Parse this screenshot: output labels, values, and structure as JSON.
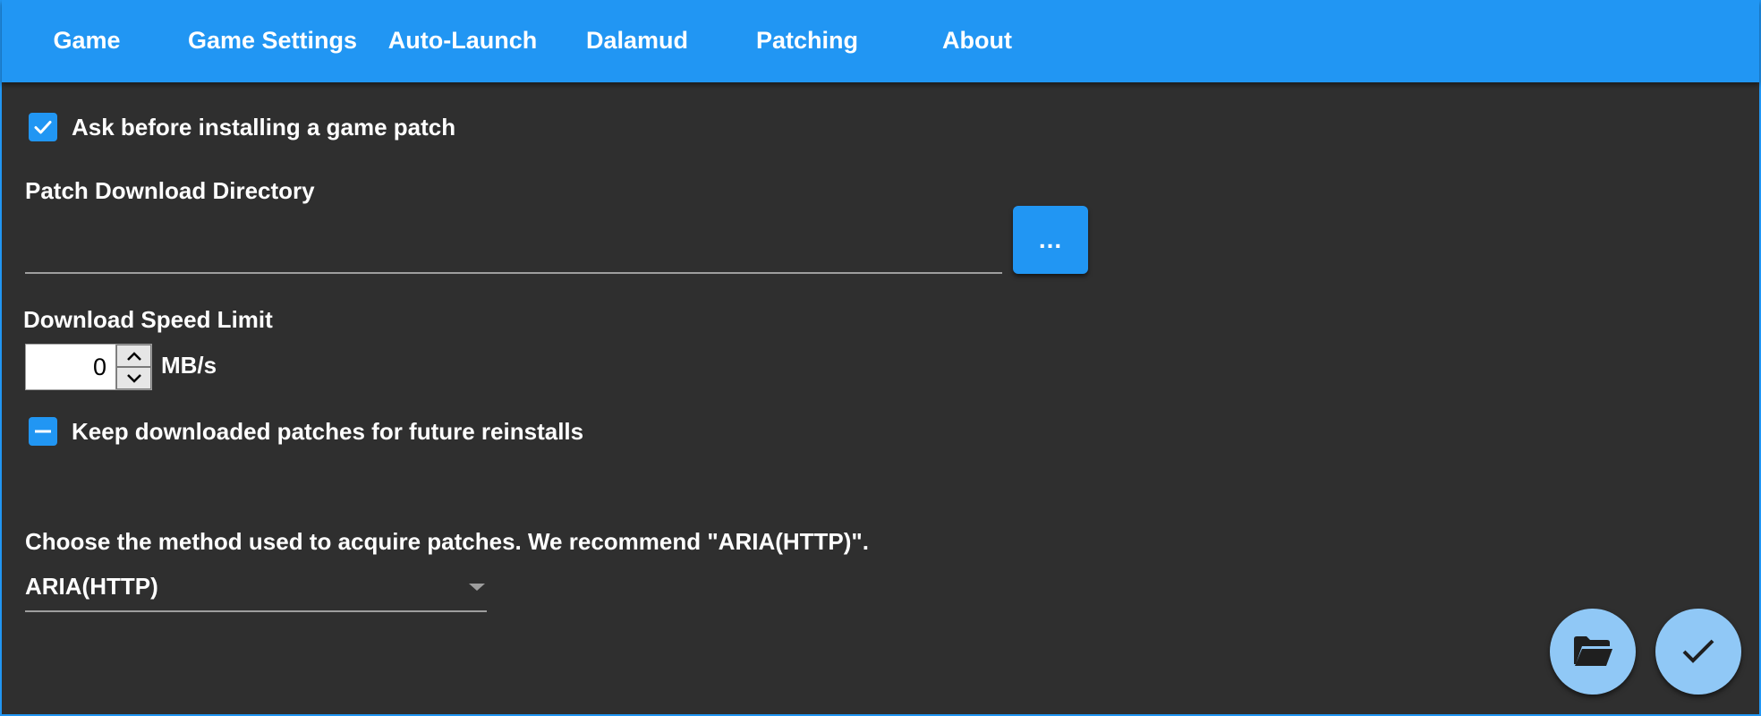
{
  "tabs": [
    {
      "label": "Game"
    },
    {
      "label": "Game Settings"
    },
    {
      "label": "Auto-Launch"
    },
    {
      "label": "Dalamud"
    },
    {
      "label": "Patching"
    },
    {
      "label": "About"
    }
  ],
  "active_tab": "Patching",
  "patching": {
    "ask_before_install_label": "Ask before installing a game patch",
    "ask_before_install_state": "checked",
    "download_dir_label": "Patch Download Directory",
    "download_dir_value": "",
    "browse_label": "...",
    "speed_limit_label": "Download Speed Limit",
    "speed_limit_value": "0",
    "speed_limit_unit": "MB/s",
    "keep_patches_label": "Keep downloaded patches for future reinstalls",
    "keep_patches_state": "indeterminate",
    "method_prompt": "Choose the method used to acquire patches. We recommend \"ARIA(HTTP)\".",
    "method_value": "ARIA(HTTP)"
  },
  "icons": {
    "folder": "folder-open-icon",
    "check": "check-icon",
    "dropdown": "chevron-down-icon",
    "spin_up": "chevron-up-icon",
    "spin_down": "chevron-down-icon"
  },
  "colors": {
    "accent": "#2196f3",
    "fab": "#90c8f6",
    "background": "#2f2f2f"
  }
}
